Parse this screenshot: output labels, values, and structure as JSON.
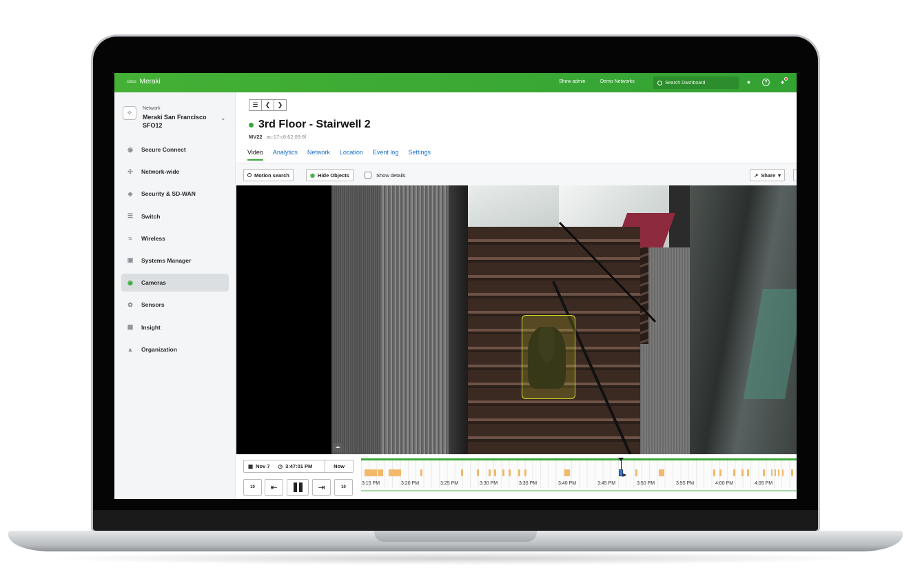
{
  "topbar": {
    "brand_mark": "cisco",
    "brand_name": "Meraki",
    "show_admin": "Show admin",
    "demo_networks": "Demo Networks",
    "search_placeholder": "Search Dashboard",
    "icons": [
      "user-icon",
      "help-icon",
      "bell-icon"
    ],
    "accent": "#3aa93a"
  },
  "sidebar": {
    "network_caption": "Network",
    "network_name": "Meraki San Francisco SFO12",
    "items": [
      {
        "label": "Secure Connect",
        "icon": "secure-connect-icon",
        "active": false
      },
      {
        "label": "Network-wide",
        "icon": "network-wide-icon",
        "active": false
      },
      {
        "label": "Security & SD-WAN",
        "icon": "shield-icon",
        "active": false
      },
      {
        "label": "Switch",
        "icon": "switch-icon",
        "active": false
      },
      {
        "label": "Wireless",
        "icon": "wifi-icon",
        "active": false
      },
      {
        "label": "Systems Manager",
        "icon": "systems-manager-icon",
        "active": false
      },
      {
        "label": "Cameras",
        "icon": "camera-icon",
        "active": true
      },
      {
        "label": "Sensors",
        "icon": "sensor-icon",
        "active": false
      },
      {
        "label": "Insight",
        "icon": "insight-icon",
        "active": false
      },
      {
        "label": "Organization",
        "icon": "organization-icon",
        "active": false
      }
    ]
  },
  "main": {
    "pager_icons": [
      "list-icon",
      "chevron-left-icon",
      "chevron-right-icon"
    ],
    "camera_title": "3rd Floor - Stairwell 2",
    "model": "MV22",
    "mac": "ac:17:c8:62:09:6f",
    "status_color": "#3aa93a",
    "tabs": [
      {
        "label": "Video",
        "active": true
      },
      {
        "label": "Analytics",
        "active": false
      },
      {
        "label": "Network",
        "active": false
      },
      {
        "label": "Location",
        "active": false
      },
      {
        "label": "Event log",
        "active": false
      },
      {
        "label": "Settings",
        "active": false
      }
    ],
    "toolbar": {
      "motion_search": "Motion search",
      "hide_objects": "Hide Objects",
      "show_details": "Show details",
      "share": "Share"
    },
    "player": {
      "date": "Nov 7",
      "time": "3:47:01 PM",
      "now": "Now",
      "rewind_label": "10",
      "forward_label": "10"
    },
    "timeline": {
      "labels": [
        "3:15 PM",
        "3:20 PM",
        "3:25 PM",
        "3:30 PM",
        "3:35 PM",
        "3:40 PM",
        "3:45 PM",
        "3:50 PM",
        "3:55 PM",
        "4:00 PM",
        "4:05 PM"
      ],
      "event_color": "#f2b96b",
      "playhead_time": "3:47:01 PM"
    }
  }
}
